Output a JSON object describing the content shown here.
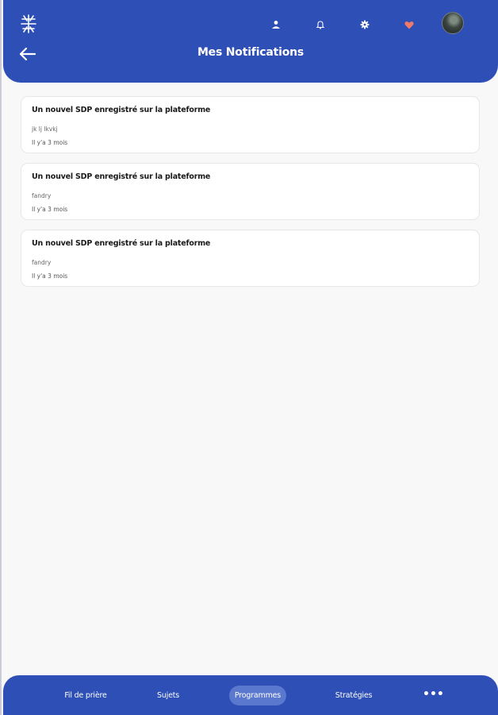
{
  "header": {
    "title": "Mes Notifications",
    "icons": {
      "logo": "ornate-logo-icon",
      "user": "user-icon",
      "bell": "bell-icon",
      "settings": "gear-icon",
      "favorites": "heart-icon",
      "back": "arrow-left-icon"
    },
    "colors": {
      "primary": "#2d4fb6",
      "heart": "#f07a6a"
    }
  },
  "notifications": [
    {
      "title": "Un nouvel SDP enregistré sur la plateforme",
      "author": "jk lj lkvkj",
      "time": "Il y'a 3 mois"
    },
    {
      "title": "Un nouvel SDP enregistré sur la plateforme",
      "author": "fandry",
      "time": "Il y'a 3 mois"
    },
    {
      "title": "Un nouvel SDP enregistré sur la plateforme",
      "author": "fandry",
      "time": "Il y'a 3 mois"
    }
  ],
  "bottom_nav": {
    "items": [
      {
        "label": "Fil de prière",
        "active": false
      },
      {
        "label": "Sujets",
        "active": false
      },
      {
        "label": "Programmes",
        "active": true
      },
      {
        "label": "Stratégies",
        "active": false
      }
    ],
    "more": "•••"
  }
}
